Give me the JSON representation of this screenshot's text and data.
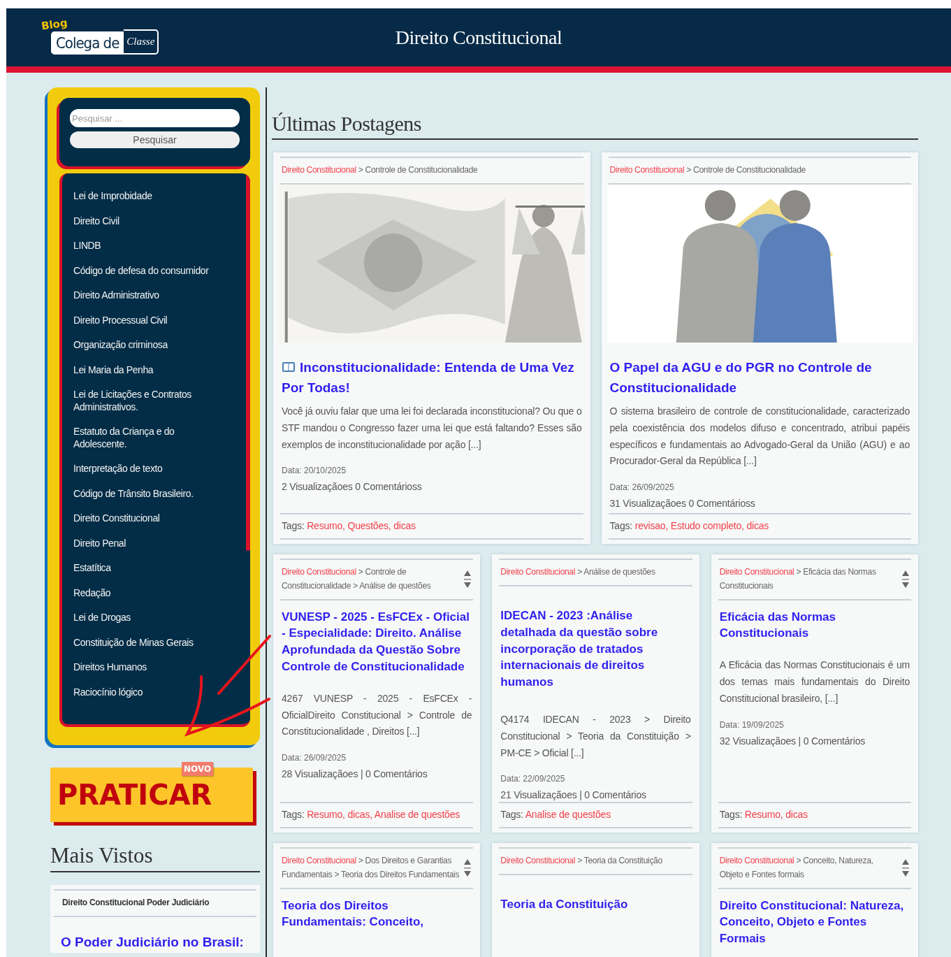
{
  "header": {
    "logo": {
      "tag": "Blog",
      "name": "Colega de",
      "script": "Classe"
    },
    "title": "Direito Constitucional"
  },
  "sidebar": {
    "search": {
      "placeholder": "Pesquisar ...",
      "button": "Pesquisar"
    },
    "menu": [
      "Lei de Improbidade",
      "Direito Civil",
      "LINDB",
      "Código de defesa do consumidor",
      "Direito Administrativo",
      "Direito Processual Civil",
      "Organização criminosa",
      "Lei Maria da Penha",
      "Lei de Licitações e Contratos Administrativos.",
      "Estatuto da Criança e do Adolescente.",
      "Interpretação de texto",
      "Código de Trânsito Brasileiro.",
      "Direito Constitucional",
      "Direito Penal",
      "Estatítica",
      "Redação",
      "Lei de Drogas",
      "Constituição de Minas Gerais",
      "Direitos Humanos",
      "Raciocínio lógico"
    ],
    "promo": {
      "label": "PRATICAR",
      "badge": "NOVO"
    },
    "most_viewed": {
      "heading": "Mais Vistos",
      "posts": [
        {
          "breadcrumb": "Direito Constitucional Poder Judiciário",
          "title": "O Poder Judiciário no Brasil:"
        }
      ]
    }
  },
  "main": {
    "heading": "Últimas Postagens",
    "rows": [
      {
        "posts": [
          {
            "category": "Direito Constitucional",
            "path": "> Controle de Constitucionalidade",
            "scroll_arrows": false,
            "book_icon": true,
            "title": "Inconstitucionalidade: Entenda de Uma Vez Por Todas!",
            "excerpt": "Você já ouviu falar que uma lei foi declarada inconstitucional? Ou que o STF mandou o Congresso fazer uma lei que está faltando? Esses são exemplos de inconstitucionalidade por ação [...]",
            "date": "Data: 20/10/2025",
            "stats": "2 Visualizaçãoes 0 Comentárioss",
            "tags_label": "Tags:",
            "tags": [
              "Resumo,",
              "Questões,",
              "dicas"
            ]
          },
          {
            "category": "Direito Constitucional",
            "path": "> Controle de Constitucionalidade",
            "scroll_arrows": false,
            "book_icon": false,
            "title": "O Papel da AGU e do PGR no Controle de Constitucionalidade",
            "excerpt": "O sistema brasileiro de controle de constitucionalidade, caracterizado pela coexistência dos modelos difuso e concentrado, atribui papéis específicos e fundamentais ao Advogado-Geral da União (AGU) e ao Procurador-Geral da República [...]",
            "date": "Data: 26/09/2025",
            "stats": "31 Visualizaçãoes 0 Comentárioss",
            "tags_label": "Tags:",
            "tags": [
              "revisao,",
              "Estudo completo,",
              "dicas"
            ]
          }
        ]
      },
      {
        "posts": [
          {
            "category": "Direito Constitucional",
            "path": "> Controle de Constitucionalidade > Análise de questões",
            "scroll_arrows": true,
            "book_icon": false,
            "title": "VUNESP - 2025 - EsFCEx - Oficial - Especialidade: Direito. Análise Aprofundada da Questão Sobre Controle de Constitucionalidade",
            "excerpt": "4267 VUNESP - 2025 - EsFCEx - OficialDireito Constitucional > Controle de Constitucionalidade , Direitos [...]",
            "date": "Data: 26/09/2025",
            "stats": "28 Visualizaçãoes | 0 Comentários",
            "tags_label": "Tags:",
            "tags": [
              "Resumo,",
              "dicas,",
              "Analise de questões"
            ]
          },
          {
            "category": "Direito Constitucional",
            "path": "> Análise de questões",
            "scroll_arrows": false,
            "book_icon": false,
            "title": "IDECAN - 2023 :Análise detalhada da questão sobre incorporação de tratados internacionais de direitos humanos",
            "excerpt": "Q4174 IDECAN - 2023 > Direito Constitucional > Teoria da Constituição > PM-CE > Oficial [...]",
            "date": "Data: 22/09/2025",
            "stats": "21 Visualizaçãoes | 0 Comentários",
            "tags_label": "Tags:",
            "tags": [
              "Analise de questões"
            ]
          },
          {
            "category": "Direito Constitucional",
            "path": "> Eficácia das Normas Constitucionais",
            "scroll_arrows": true,
            "book_icon": false,
            "title": "Eficácia das Normas Constitucionais",
            "excerpt": "A Eficácia das Normas Constitucionais é um dos temas mais fundamentais do Direito Constitucional brasileiro, [...]",
            "date": "Data: 19/09/2025",
            "stats": "32 Visualizaçãoes | 0 Comentários",
            "tags_label": "Tags:",
            "tags": [
              "Resumo,",
              "dicas"
            ]
          }
        ]
      },
      {
        "posts": [
          {
            "category": "Direito Constitucional",
            "path": "> Dos Direitos e Garantias Fundamentais > Teoria dos Direitos Fundamentais",
            "scroll_arrows": true,
            "book_icon": false,
            "title": "Teoria dos Direitos Fundamentais: Conceito,"
          },
          {
            "category": "Direito Constitucional",
            "path": "> Teoria da Constituição",
            "scroll_arrows": false,
            "book_icon": false,
            "title": "Teoria da Constituição"
          },
          {
            "category": "Direito Constitucional",
            "path": "> Conceito, Natureza, Objeto e Fontes formais",
            "scroll_arrows": true,
            "book_icon": false,
            "title": "Direito Constitucional: Natureza, Conceito, Objeto e Fontes Formais"
          }
        ]
      }
    ]
  }
}
